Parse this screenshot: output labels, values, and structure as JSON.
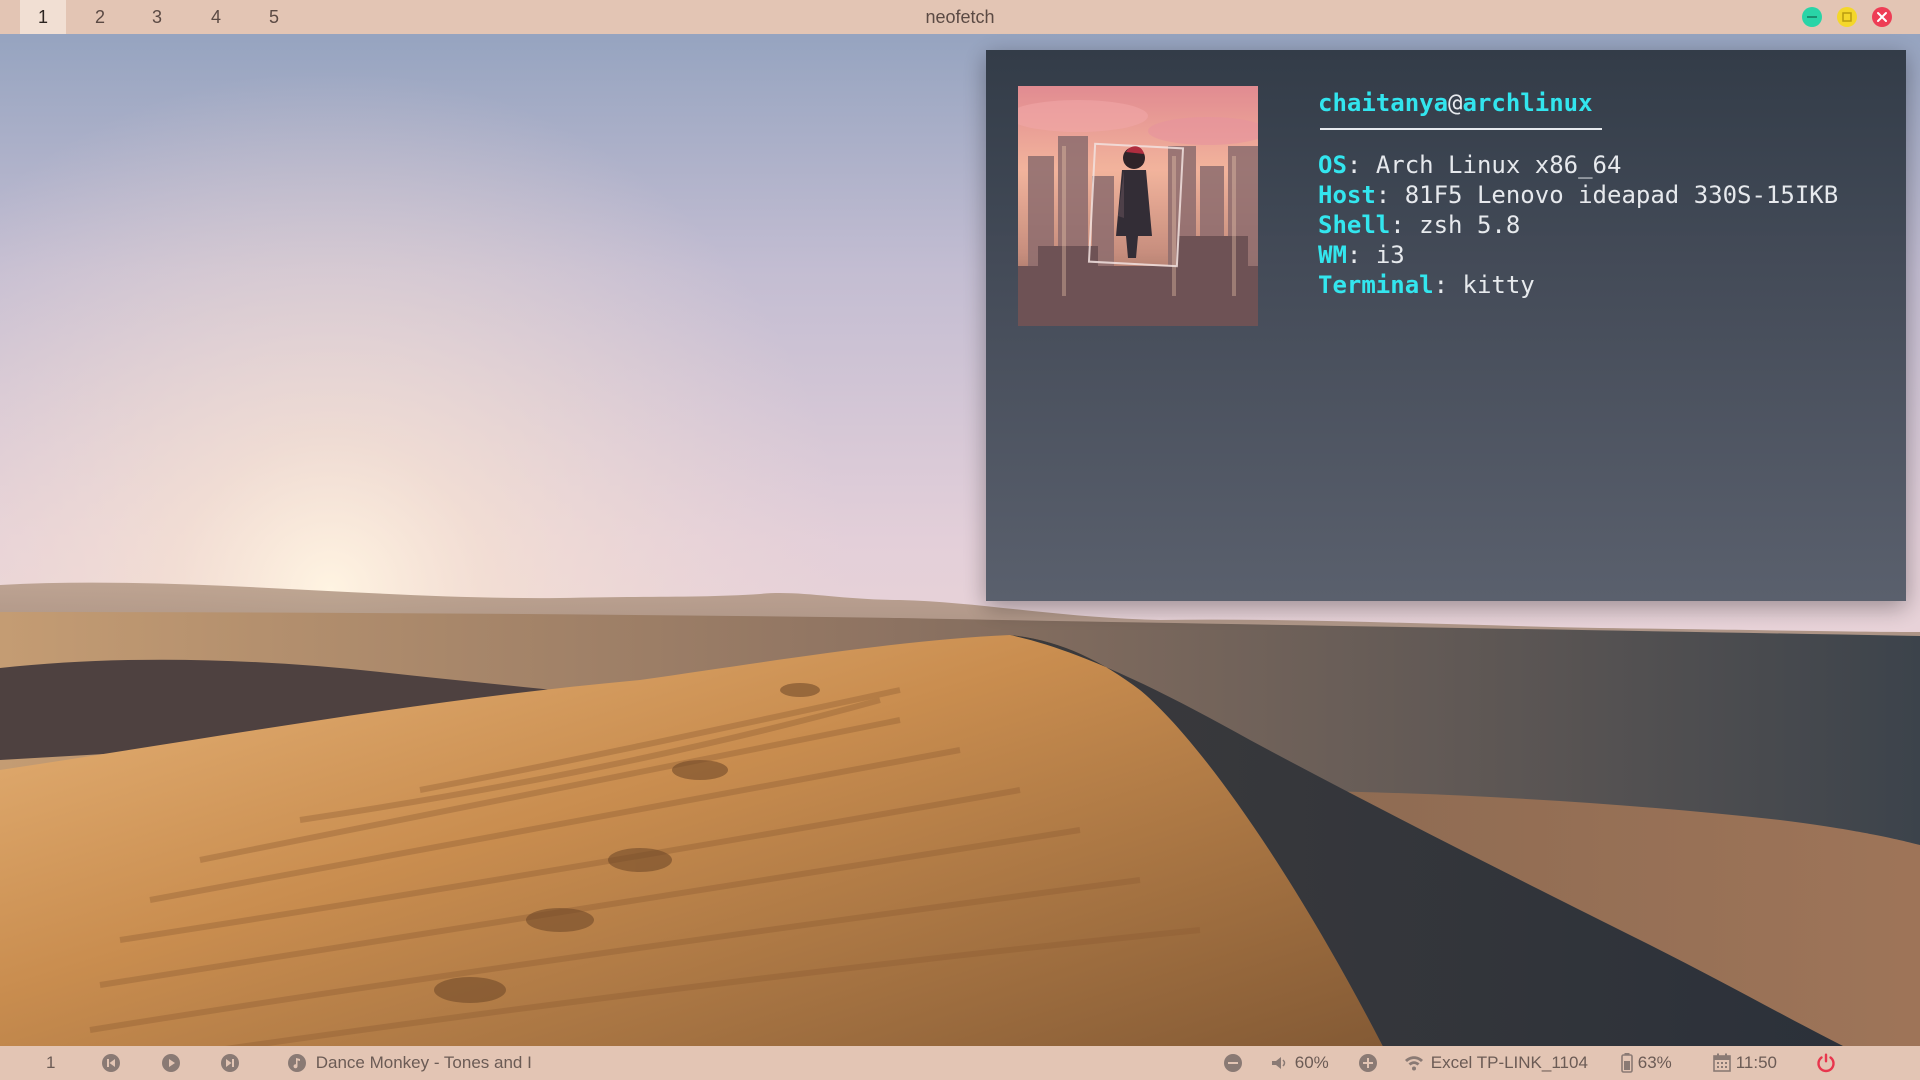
{
  "topbar": {
    "workspaces": [
      "1",
      "2",
      "3",
      "4",
      "5"
    ],
    "active_workspace": "1",
    "window_title": "neofetch",
    "window_buttons": [
      {
        "name": "minimize-icon",
        "color": "#29d4a7"
      },
      {
        "name": "maximize-icon",
        "color": "#f4d72a"
      },
      {
        "name": "close-icon",
        "color": "#ee3d55"
      }
    ]
  },
  "terminal": {
    "user": "chaitanya",
    "at": "@",
    "host": "archlinux",
    "fields": [
      {
        "key": "OS",
        "value": "Arch Linux x86_64"
      },
      {
        "key": "Host",
        "value": "81F5 Lenovo ideapad 330S-15IKB"
      },
      {
        "key": "Shell",
        "value": "zsh 5.8"
      },
      {
        "key": "WM",
        "value": "i3"
      },
      {
        "key": "Terminal",
        "value": "kitty"
      }
    ],
    "key_color": "#2ee8f0"
  },
  "bottombar": {
    "workspace": "1",
    "media": {
      "prev_icon": "skip-previous-icon",
      "play_icon": "play-icon",
      "next_icon": "skip-next-icon",
      "music_icon": "music-note-icon",
      "track": "Dance Monkey - Tones and I"
    },
    "volume": {
      "decrease_icon": "minus-circle-icon",
      "speaker_icon": "speaker-icon",
      "level": "60%",
      "increase_icon": "plus-circle-icon"
    },
    "network": {
      "icon": "wifi-icon",
      "ssid": "Excel TP-LINK_1104"
    },
    "battery": {
      "icon": "battery-icon",
      "level": "63%"
    },
    "clock": {
      "icon": "calendar-icon",
      "time": "11:50"
    },
    "power": {
      "icon": "power-icon",
      "color": "#e8364d"
    }
  }
}
